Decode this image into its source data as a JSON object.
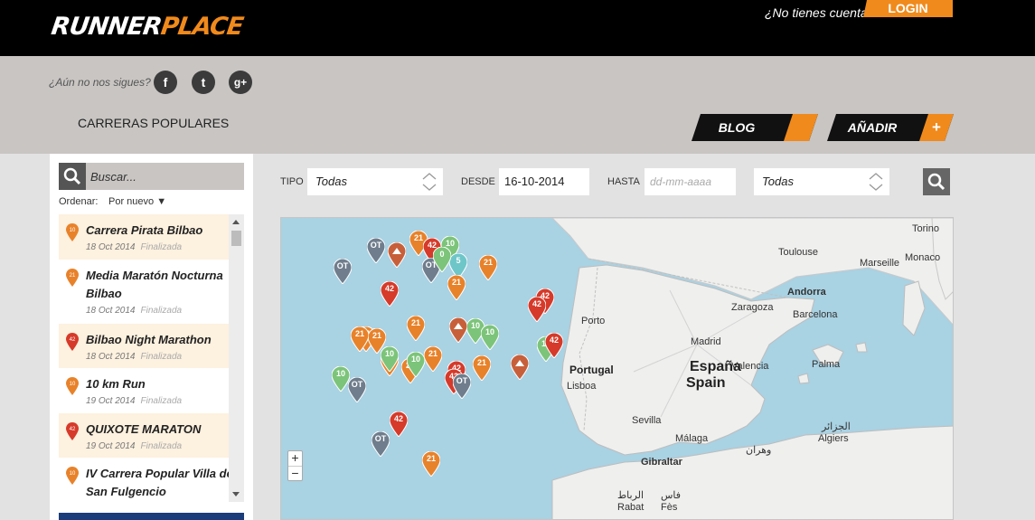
{
  "brand": {
    "logo_part1": "RUNNER",
    "logo_part2": "PLACE"
  },
  "header": {
    "account_question": "¿No tienes cuenta?",
    "login_label": "LOGIN",
    "follow_text": "¿Aún no nos sigues?",
    "social": {
      "facebook": "f",
      "twitter": "t",
      "googleplus": "g+"
    },
    "section_title": "CARRERAS POPULARES",
    "blog_label": "BLOG",
    "add_label": "AÑADIR",
    "add_icon": "+"
  },
  "sidebar": {
    "search_placeholder": "Buscar...",
    "sort_label": "Ordenar:",
    "sort_value": "Por nuevo",
    "races": [
      {
        "name": "Carrera Pirata Bilbao",
        "date": "18 Oct 2014",
        "status": "Finalizada",
        "badge": "10",
        "badge_color": "#e8822a"
      },
      {
        "name": "Media Maratón Nocturna Bilbao",
        "date": "18 Oct 2014",
        "status": "Finalizada",
        "badge": "21",
        "badge_color": "#e8822a"
      },
      {
        "name": "Bilbao Night Marathon",
        "date": "18 Oct 2014",
        "status": "Finalizada",
        "badge": "42",
        "badge_color": "#d63a2a"
      },
      {
        "name": "10 km Run",
        "date": "19 Oct 2014",
        "status": "Finalizada",
        "badge": "10",
        "badge_color": "#e8822a"
      },
      {
        "name": "QUIXOTE MARATON",
        "date": "19 Oct 2014",
        "status": "Finalizada",
        "badge": "42",
        "badge_color": "#d63a2a"
      },
      {
        "name": "IV Carrera Popular Villa de San Fulgencio",
        "date": "",
        "status": "",
        "badge": "10",
        "badge_color": "#e8822a"
      }
    ]
  },
  "filters": {
    "tipo_label": "TIPO",
    "tipo_value": "Todas",
    "desde_label": "DESDE",
    "desde_value": "16-10-2014",
    "hasta_label": "HASTA",
    "hasta_placeholder": "dd-mm-aaaa",
    "region_value": "Todas"
  },
  "map": {
    "zoom_in": "+",
    "zoom_out": "−",
    "labels": {
      "toulouse": "Toulouse",
      "marseille": "Marseille",
      "monaco": "Monaco",
      "torino": "Torino",
      "andorra": "Andorra",
      "barcelona": "Barcelona",
      "zaragoza": "Zaragoza",
      "porto": "Porto",
      "madrid": "Madrid",
      "portugal": "Portugal",
      "espana": "España",
      "spain": "Spain",
      "valencia": "Valencia",
      "lisboa": "Lisboa",
      "palma": "Palma",
      "sevilla": "Sevilla",
      "malaga": "Málaga",
      "gibraltar": "Gibraltar",
      "algiers_ar": "الجزائر",
      "algiers": "Algiers",
      "oran_ar": "وهران",
      "rabat_ar": "الرباط",
      "rabat": "Rabat",
      "fes_ar": "فاس",
      "fes": "Fès"
    },
    "marker_colors": {
      "10": "#7cc47a",
      "21": "#e8822a",
      "42": "#d63a2a",
      "OT": "#6f7d8c",
      "trail": "#c7603a",
      "5": "#6ec6c8"
    },
    "markers": [
      {
        "text": "OT",
        "type": "OT"
      },
      {
        "text": "21",
        "type": "21"
      },
      {
        "text": "42",
        "type": "42"
      },
      {
        "text": "10",
        "type": "10"
      },
      {
        "text": "OT",
        "type": "OT"
      },
      {
        "text": "OT",
        "type": "OT"
      },
      {
        "text": "5",
        "type": "5"
      },
      {
        "text": "",
        "type": "trail"
      },
      {
        "text": "21",
        "type": "21"
      },
      {
        "text": "21",
        "type": "21"
      },
      {
        "text": "42",
        "type": "42"
      },
      {
        "text": "42",
        "type": "42"
      },
      {
        "text": "42",
        "type": "42"
      },
      {
        "text": "21",
        "type": "21"
      },
      {
        "text": "21",
        "type": "21"
      },
      {
        "text": "21",
        "type": "21"
      },
      {
        "text": "10",
        "type": "10"
      },
      {
        "text": "21",
        "type": "21"
      },
      {
        "text": "10",
        "type": "10"
      },
      {
        "text": "21",
        "type": "21"
      },
      {
        "text": "21",
        "type": "21"
      },
      {
        "text": "10",
        "type": "10"
      },
      {
        "text": "21",
        "type": "21"
      },
      {
        "text": "42",
        "type": "42"
      },
      {
        "text": "10",
        "type": "10"
      },
      {
        "text": "10",
        "type": "10"
      },
      {
        "text": "OT",
        "type": "OT"
      },
      {
        "text": "42",
        "type": "42"
      },
      {
        "text": "OT",
        "type": "OT"
      },
      {
        "text": "21",
        "type": "21"
      },
      {
        "text": "",
        "type": "trail"
      },
      {
        "text": "10",
        "type": "10"
      },
      {
        "text": "42",
        "type": "42"
      },
      {
        "text": "42",
        "type": "42"
      },
      {
        "text": "OT",
        "type": "OT"
      },
      {
        "text": "21",
        "type": "21"
      },
      {
        "text": "0",
        "type": "10"
      },
      {
        "text": "",
        "type": "trail"
      }
    ]
  }
}
